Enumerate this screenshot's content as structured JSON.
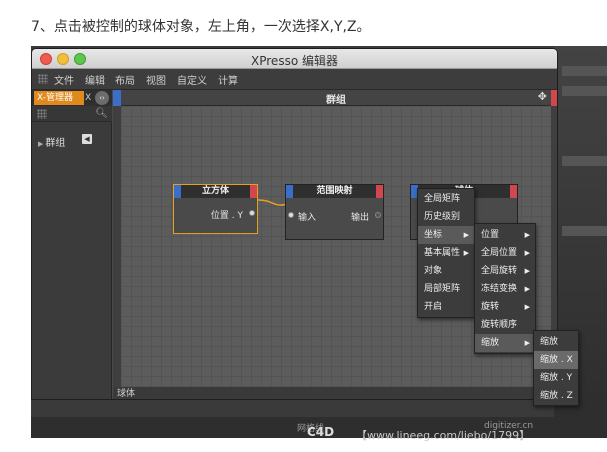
{
  "caption": "7、点击被控制的球体对象，左上角，一次选择X,Y,Z。",
  "window": {
    "title": "XPresso 编辑器",
    "menu": [
      "文件",
      "编辑",
      "布局",
      "视图",
      "自定义",
      "计算"
    ]
  },
  "left_panel": {
    "tab_active": "X-管理器",
    "tab_second": "X",
    "tree_item": "群组"
  },
  "main": {
    "group_title": "群组",
    "status": "球体"
  },
  "nodes": {
    "cube": {
      "title": "立方体",
      "port_out": "位置 . Y"
    },
    "range": {
      "title": "范围映射",
      "port_in": "输入",
      "port_out": "输出"
    },
    "sphere": {
      "title": "球体"
    }
  },
  "menu1": [
    "全局矩阵",
    "历史级别",
    "坐标",
    "基本属性",
    "对象",
    "局部矩阵",
    "开启"
  ],
  "menu2": [
    "位置",
    "全局位置",
    "全局旋转",
    "冻结变换",
    "旋转",
    "旋转顺序",
    "缩放"
  ],
  "menu3": [
    "缩放",
    "缩放 . X",
    "缩放 . Y",
    "缩放 . Z"
  ],
  "watermark": {
    "bottom_left": "网格线",
    "bottom_right": "digitizer.cn",
    "logo": "C4D",
    "url": "【www.lineeg.com/liebo/1799】"
  },
  "colors": {
    "accent_orange": "#e08a1d",
    "node_blue": "#3b6ec8",
    "node_red": "#d0474d"
  }
}
